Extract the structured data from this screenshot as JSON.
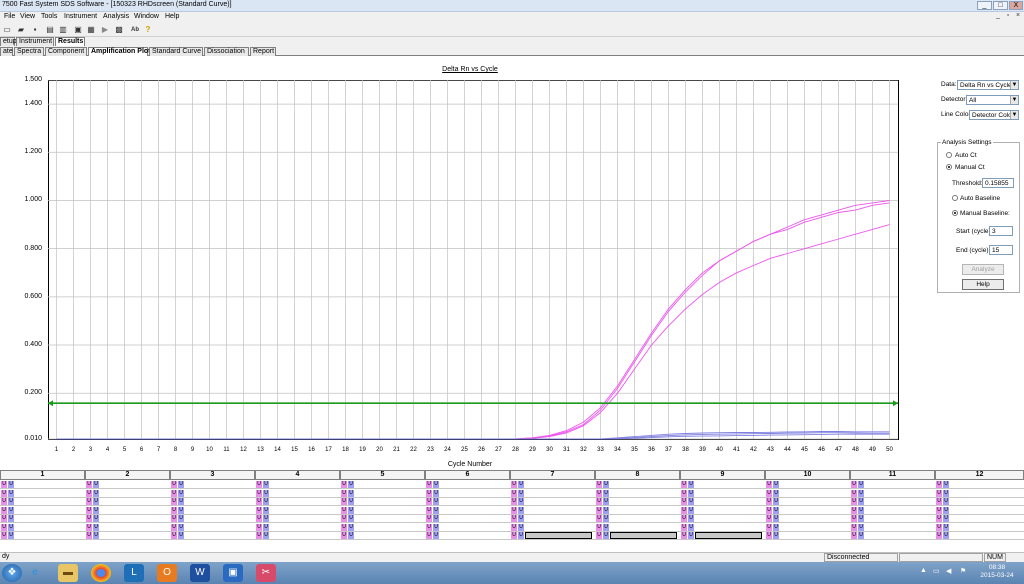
{
  "window": {
    "title": "7500 Fast System SDS Software - [150323 RHDscreen (Standard Curve)]",
    "min": "_",
    "max": "□",
    "close": "X"
  },
  "menu": [
    "File",
    "View",
    "Tools",
    "Instrument",
    "Analysis",
    "Window",
    "Help"
  ],
  "tabs_top": [
    {
      "label": "etup",
      "active": false
    },
    {
      "label": "Instrument",
      "active": false
    },
    {
      "label": "Results",
      "active": true
    }
  ],
  "tabs_second": [
    {
      "label": "ate",
      "active": false
    },
    {
      "label": "Spectra",
      "active": false
    },
    {
      "label": "Component",
      "active": false
    },
    {
      "label": "Amplification Plot",
      "active": true
    },
    {
      "label": "Standard Curve",
      "active": false
    },
    {
      "label": "Dissociation",
      "active": false
    },
    {
      "label": "Report",
      "active": false
    }
  ],
  "side": {
    "data_label": "Data:",
    "data_value": "Delta Rn vs Cycle",
    "detector_label": "Detector:",
    "detector_value": "All",
    "linecolor_label": "Line Color:",
    "linecolor_value": "Detector Color",
    "analysis_title": "Analysis Settings",
    "auto_ct": "Auto Ct",
    "manual_ct": "Manual Ct",
    "threshold_label": "Threshold:",
    "threshold_value": "0.15855",
    "auto_baseline": "Auto Baseline",
    "manual_baseline": "Manual Baseline:",
    "start_label": "Start (cycle):",
    "start_value": "3",
    "end_label": "End (cycle):",
    "end_value": "15",
    "analyze": "Analyze",
    "help": "Help"
  },
  "chart_data": {
    "type": "line",
    "title": "Delta Rn vs Cycle",
    "xlabel": "Cycle Number",
    "ylabel": "",
    "yticks": [
      "1.500",
      "1.400",
      "1.200",
      "1.000",
      "0.800",
      "0.600",
      "0.400",
      "0.200",
      "0.010"
    ],
    "ylim": [
      0.01,
      1.5
    ],
    "x": [
      1,
      2,
      3,
      4,
      5,
      6,
      7,
      8,
      9,
      10,
      11,
      12,
      13,
      14,
      15,
      16,
      17,
      18,
      19,
      20,
      21,
      22,
      23,
      24,
      25,
      26,
      27,
      28,
      29,
      30,
      31,
      32,
      33,
      34,
      35,
      36,
      37,
      38,
      39,
      40,
      41,
      42,
      43,
      44,
      45,
      46,
      47,
      48,
      49,
      50
    ],
    "threshold": 0.15855,
    "threshold_color": "#1a9a1a",
    "grid": true,
    "series": [
      {
        "color": "#ee55ee",
        "values": [
          0.01,
          0.01,
          0.01,
          0.01,
          0.01,
          0.01,
          0.01,
          0.01,
          0.01,
          0.01,
          0.01,
          0.01,
          0.01,
          0.01,
          0.01,
          0.01,
          0.01,
          0.01,
          0.01,
          0.01,
          0.01,
          0.01,
          0.01,
          0.01,
          0.01,
          0.01,
          0.01,
          0.01,
          0.015,
          0.025,
          0.045,
          0.08,
          0.14,
          0.23,
          0.34,
          0.45,
          0.55,
          0.63,
          0.7,
          0.75,
          0.79,
          0.83,
          0.86,
          0.89,
          0.92,
          0.94,
          0.96,
          0.98,
          0.99,
          1.0
        ]
      },
      {
        "color": "#ee55ee",
        "values": [
          0.01,
          0.01,
          0.01,
          0.01,
          0.01,
          0.01,
          0.01,
          0.01,
          0.01,
          0.01,
          0.01,
          0.01,
          0.01,
          0.01,
          0.01,
          0.01,
          0.01,
          0.01,
          0.01,
          0.01,
          0.01,
          0.01,
          0.01,
          0.01,
          0.01,
          0.01,
          0.01,
          0.01,
          0.015,
          0.022,
          0.04,
          0.07,
          0.13,
          0.22,
          0.33,
          0.44,
          0.54,
          0.62,
          0.69,
          0.75,
          0.79,
          0.83,
          0.86,
          0.88,
          0.91,
          0.93,
          0.95,
          0.96,
          0.98,
          0.99
        ]
      },
      {
        "color": "#ee55ee",
        "values": [
          0.01,
          0.01,
          0.01,
          0.01,
          0.01,
          0.01,
          0.01,
          0.01,
          0.01,
          0.01,
          0.01,
          0.01,
          0.01,
          0.01,
          0.01,
          0.01,
          0.01,
          0.01,
          0.01,
          0.01,
          0.01,
          0.01,
          0.01,
          0.01,
          0.01,
          0.01,
          0.01,
          0.01,
          0.013,
          0.02,
          0.035,
          0.065,
          0.12,
          0.2,
          0.3,
          0.4,
          0.48,
          0.55,
          0.61,
          0.66,
          0.7,
          0.73,
          0.76,
          0.78,
          0.8,
          0.82,
          0.84,
          0.86,
          0.88,
          0.9
        ]
      },
      {
        "color": "#8080e0",
        "values": [
          0.01,
          0.01,
          0.01,
          0.01,
          0.01,
          0.01,
          0.01,
          0.01,
          0.01,
          0.01,
          0.01,
          0.01,
          0.01,
          0.01,
          0.01,
          0.01,
          0.01,
          0.01,
          0.01,
          0.01,
          0.01,
          0.01,
          0.01,
          0.01,
          0.01,
          0.01,
          0.01,
          0.01,
          0.01,
          0.01,
          0.01,
          0.01,
          0.01,
          0.015,
          0.02,
          0.025,
          0.03,
          0.033,
          0.035,
          0.036,
          0.037,
          0.037,
          0.038,
          0.039,
          0.04,
          0.041,
          0.041,
          0.04,
          0.04,
          0.04
        ]
      },
      {
        "color": "#8080e0",
        "values": [
          0.01,
          0.01,
          0.01,
          0.01,
          0.01,
          0.01,
          0.01,
          0.01,
          0.01,
          0.01,
          0.01,
          0.01,
          0.01,
          0.01,
          0.01,
          0.01,
          0.01,
          0.01,
          0.01,
          0.01,
          0.01,
          0.01,
          0.01,
          0.01,
          0.01,
          0.01,
          0.01,
          0.01,
          0.01,
          0.01,
          0.01,
          0.01,
          0.01,
          0.012,
          0.016,
          0.02,
          0.024,
          0.027,
          0.029,
          0.03,
          0.031,
          0.032,
          0.033,
          0.034,
          0.035,
          0.036,
          0.036,
          0.035,
          0.034,
          0.034
        ]
      },
      {
        "color": "#8080e0",
        "values": [
          0.01,
          0.01,
          0.01,
          0.01,
          0.01,
          0.01,
          0.01,
          0.01,
          0.01,
          0.01,
          0.01,
          0.01,
          0.01,
          0.01,
          0.01,
          0.01,
          0.01,
          0.01,
          0.01,
          0.01,
          0.01,
          0.01,
          0.01,
          0.01,
          0.01,
          0.01,
          0.01,
          0.01,
          0.01,
          0.01,
          0.01,
          0.01,
          0.01,
          0.011,
          0.013,
          0.016,
          0.019,
          0.021,
          0.022,
          0.023,
          0.024,
          0.025,
          0.026,
          0.027,
          0.028,
          0.029,
          0.03,
          0.03,
          0.03,
          0.03
        ]
      }
    ]
  },
  "plate": {
    "columns": [
      "1",
      "2",
      "3",
      "4",
      "5",
      "6",
      "7",
      "8",
      "9",
      "10",
      "11",
      "12"
    ],
    "well_letter": "U",
    "row_count": 7
  },
  "status": {
    "left": "dy",
    "connection": "Disconnected",
    "num": "NUM"
  },
  "taskbar": {
    "time": "08:38",
    "date": "2015-03-24"
  }
}
